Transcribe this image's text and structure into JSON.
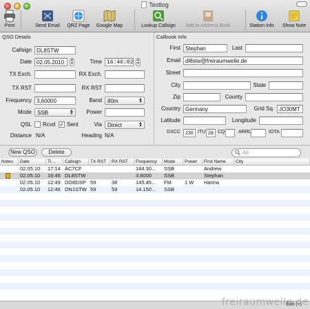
{
  "window": {
    "title": "Testlog"
  },
  "toolbar": {
    "items": [
      {
        "label": "Print",
        "icon": "printer-icon"
      },
      {
        "label": "Send Email",
        "icon": "mail-icon"
      },
      {
        "label": "QRZ Page",
        "icon": "globe-icon"
      },
      {
        "label": "Google Map",
        "icon": "map-icon"
      },
      {
        "label": "Lookup Callsign",
        "icon": "lookup-icon"
      },
      {
        "label": "Add to Address Book",
        "icon": "address-book-icon",
        "disabled": true
      },
      {
        "label": "Station Info",
        "icon": "info-icon"
      },
      {
        "label": "Show Note",
        "icon": "note-icon"
      }
    ]
  },
  "qso": {
    "section_label": "QSO Details",
    "callsign_label": "Callsign",
    "callsign": "DL8STW",
    "date_label": "Date",
    "date": "02.05.2010",
    "time_label": "Time",
    "time": "16:46:02",
    "tx_exch_label": "TX Exch.",
    "tx_exch": "",
    "rx_exch_label": "RX Exch.",
    "rx_exch": "",
    "tx_rst_label": "TX RST",
    "tx_rst": "",
    "rx_rst_label": "RX RST",
    "rx_rst": "",
    "frequency_label": "Frequency",
    "frequency": "3,60000",
    "band_label": "Band",
    "band": "80m",
    "mode_label": "Mode",
    "mode": "SSB",
    "power_label": "Power",
    "power": "",
    "qsl_label": "QSL",
    "rcvd_label": "Rcvd",
    "rcvd_checked": false,
    "sent_label": "Sent",
    "sent_checked": true,
    "sent_mark": "✓",
    "via_label": "Via",
    "via": "Direct",
    "distance_label": "Distance",
    "distance": "N/A",
    "heading_label": "Heading",
    "heading": "N/A"
  },
  "callbook": {
    "section_label": "Callbook Info",
    "first_label": "First",
    "first": "Stephan",
    "last_label": "Last",
    "last": "",
    "email_label": "Email",
    "email": "dl8stw@freiraumwelle.de",
    "street_label": "Street",
    "street": "",
    "city_label": "City",
    "city": "",
    "state_label": "State",
    "state": "",
    "zip_label": "Zip",
    "zip": "",
    "county_label": "County",
    "county": "",
    "country_label": "Country",
    "country": "Germany",
    "grid_label": "Grid Sq.",
    "grid": "JO30MT",
    "latitude_label": "Latitude",
    "latitude": "",
    "longitude_label": "Longitude",
    "longitude": "",
    "dxcc_label": "DXCC",
    "dxcc": "230",
    "itu_label": "ITU",
    "itu": "28",
    "cq_label": "CQ",
    "cq": "",
    "arrl_label": "ARRL",
    "arrl": "",
    "iota_label": "IOTA",
    "iota": ""
  },
  "list": {
    "new_qso_label": "New QSO",
    "delete_label": "Delete",
    "search_placeholder": "All",
    "columns": [
      "Notes",
      "Date",
      "Ti…",
      "Callsign",
      "TX RST",
      "RX RST",
      "Frequency",
      "Mode",
      "Power",
      "First Name",
      "City"
    ],
    "rows": [
      {
        "note": false,
        "date": "02.05.10",
        "time": "17:14",
        "callsign": "AC7CF",
        "tx_rst": "",
        "rx_rst": "",
        "frequency": "144.30…",
        "mode": "SSB",
        "power": "",
        "first_name": "Andrew",
        "city": ""
      },
      {
        "note": true,
        "date": "02.05.10",
        "time": "16:46",
        "callsign": "DL8STW",
        "tx_rst": "",
        "rx_rst": "",
        "frequency": "3.6000",
        "mode": "SSB",
        "power": "",
        "first_name": "Stephan",
        "city": ""
      },
      {
        "note": false,
        "date": "02.05.10",
        "time": "12:49",
        "callsign": "DO8DSP",
        "tx_rst": "59",
        "rx_rst": "38",
        "frequency": "145.45…",
        "mode": "FM",
        "power": "1 W",
        "first_name": "Hanna",
        "city": ""
      },
      {
        "note": false,
        "date": "02.05.10",
        "time": "12:46",
        "callsign": "DN1STW",
        "tx_rst": "59",
        "rx_rst": "59",
        "frequency": "14.150…",
        "mode": "SSB",
        "power": "",
        "first_name": "",
        "city": ""
      }
    ],
    "selected_row_index": 1
  },
  "status": {
    "watermark": "freiraumwelle.de",
    "small_text": "Edit (+)"
  },
  "colors": {
    "alt_row": "#edf3fe",
    "selected_row": "#d4d4d4"
  }
}
